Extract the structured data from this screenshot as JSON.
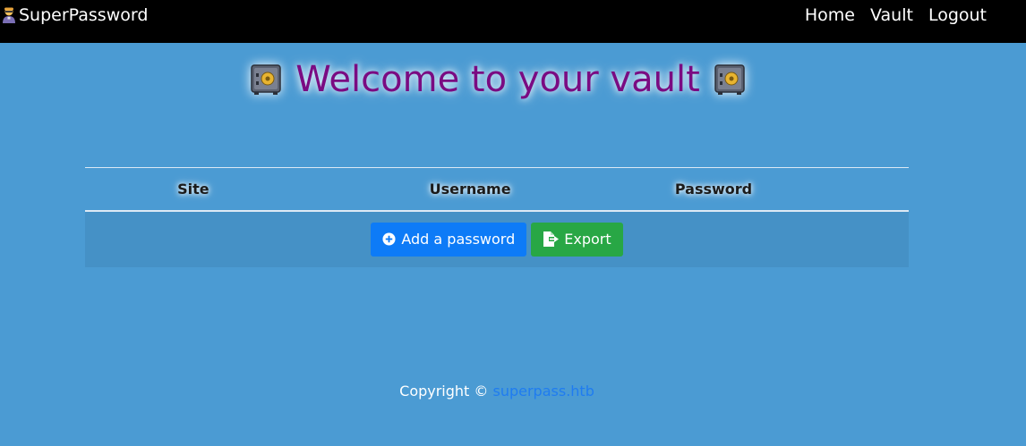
{
  "nav": {
    "brand": "SuperPassword",
    "brand_icon": "superhero-icon",
    "links": [
      "Home",
      "Vault",
      "Logout"
    ]
  },
  "main": {
    "heading": "Welcome to your vault",
    "heading_icon": "safe-icon",
    "heading_color": "#7a0b82",
    "table": {
      "columns": [
        "Site",
        "Username",
        "Password",
        ""
      ]
    },
    "buttons": {
      "add_label": "Add a password",
      "export_label": "Export"
    }
  },
  "footer": {
    "copyright_text": "Copyright ©",
    "link_text": "superpass.htb"
  },
  "colors": {
    "background": "#4b9bd3",
    "navbar": "#000000",
    "add_button": "#0d7bf7",
    "export_button": "#28a745"
  }
}
